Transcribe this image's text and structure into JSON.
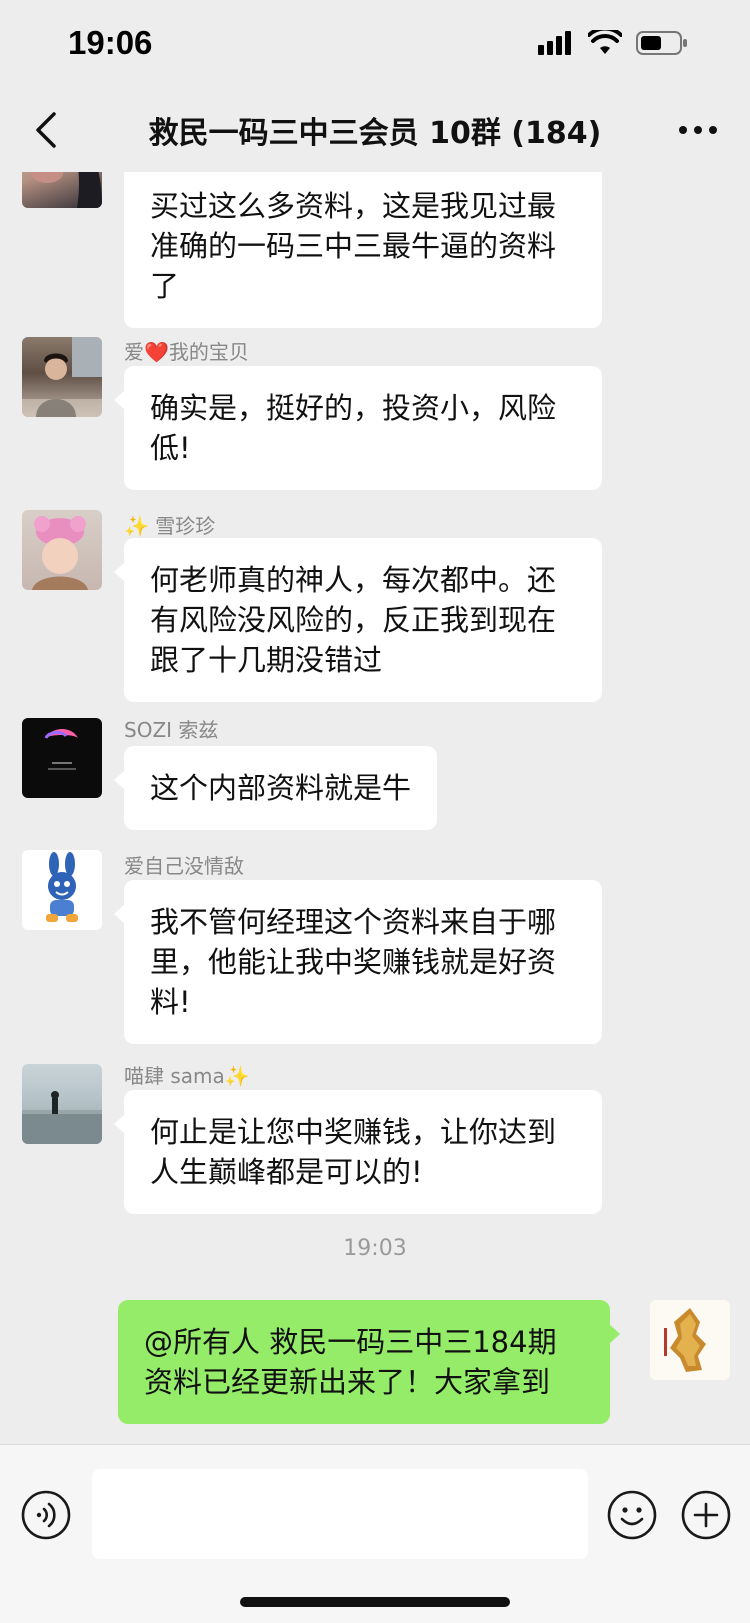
{
  "status_bar": {
    "time": "19:06"
  },
  "header": {
    "title": "救民一码三中三会员 10群 (184)"
  },
  "messages": [
    {
      "sender": "",
      "text": "买过这么多资料，这是我见过最准确的一码三中三最牛逼的资料了"
    },
    {
      "sender": "爱❤️我的宝贝",
      "text": "确实是，挺好的，投资小，风险低!"
    },
    {
      "sender": "✨ 雪珍珍",
      "text": "何老师真的神人，每次都中。还有风险没风险的，反正我到现在跟了十几期没错过"
    },
    {
      "sender": "SOZI 索兹",
      "text": "这个内部资料就是牛"
    },
    {
      "sender": "爱自己没情敌",
      "text": "我不管何经理这个资料来自于哪里，他能让我中奖赚钱就是好资料!"
    },
    {
      "sender": "喵肆 sama✨",
      "text": "何止是让您中奖赚钱，让你达到人生巅峰都是可以的!"
    }
  ],
  "timestamp": "19:03",
  "my_message": {
    "text": "@所有人  救民一码三中三184期资料已经更新出来了！大家拿到"
  },
  "input": {
    "value": ""
  },
  "colors": {
    "background": "#ededed",
    "my_bubble": "#95ec69",
    "other_bubble": "#ffffff"
  },
  "icons": {
    "back": "chevron-left-icon",
    "more": "more-dots-icon",
    "voice": "voice-icon",
    "emoji": "emoji-icon",
    "plus": "plus-icon"
  }
}
